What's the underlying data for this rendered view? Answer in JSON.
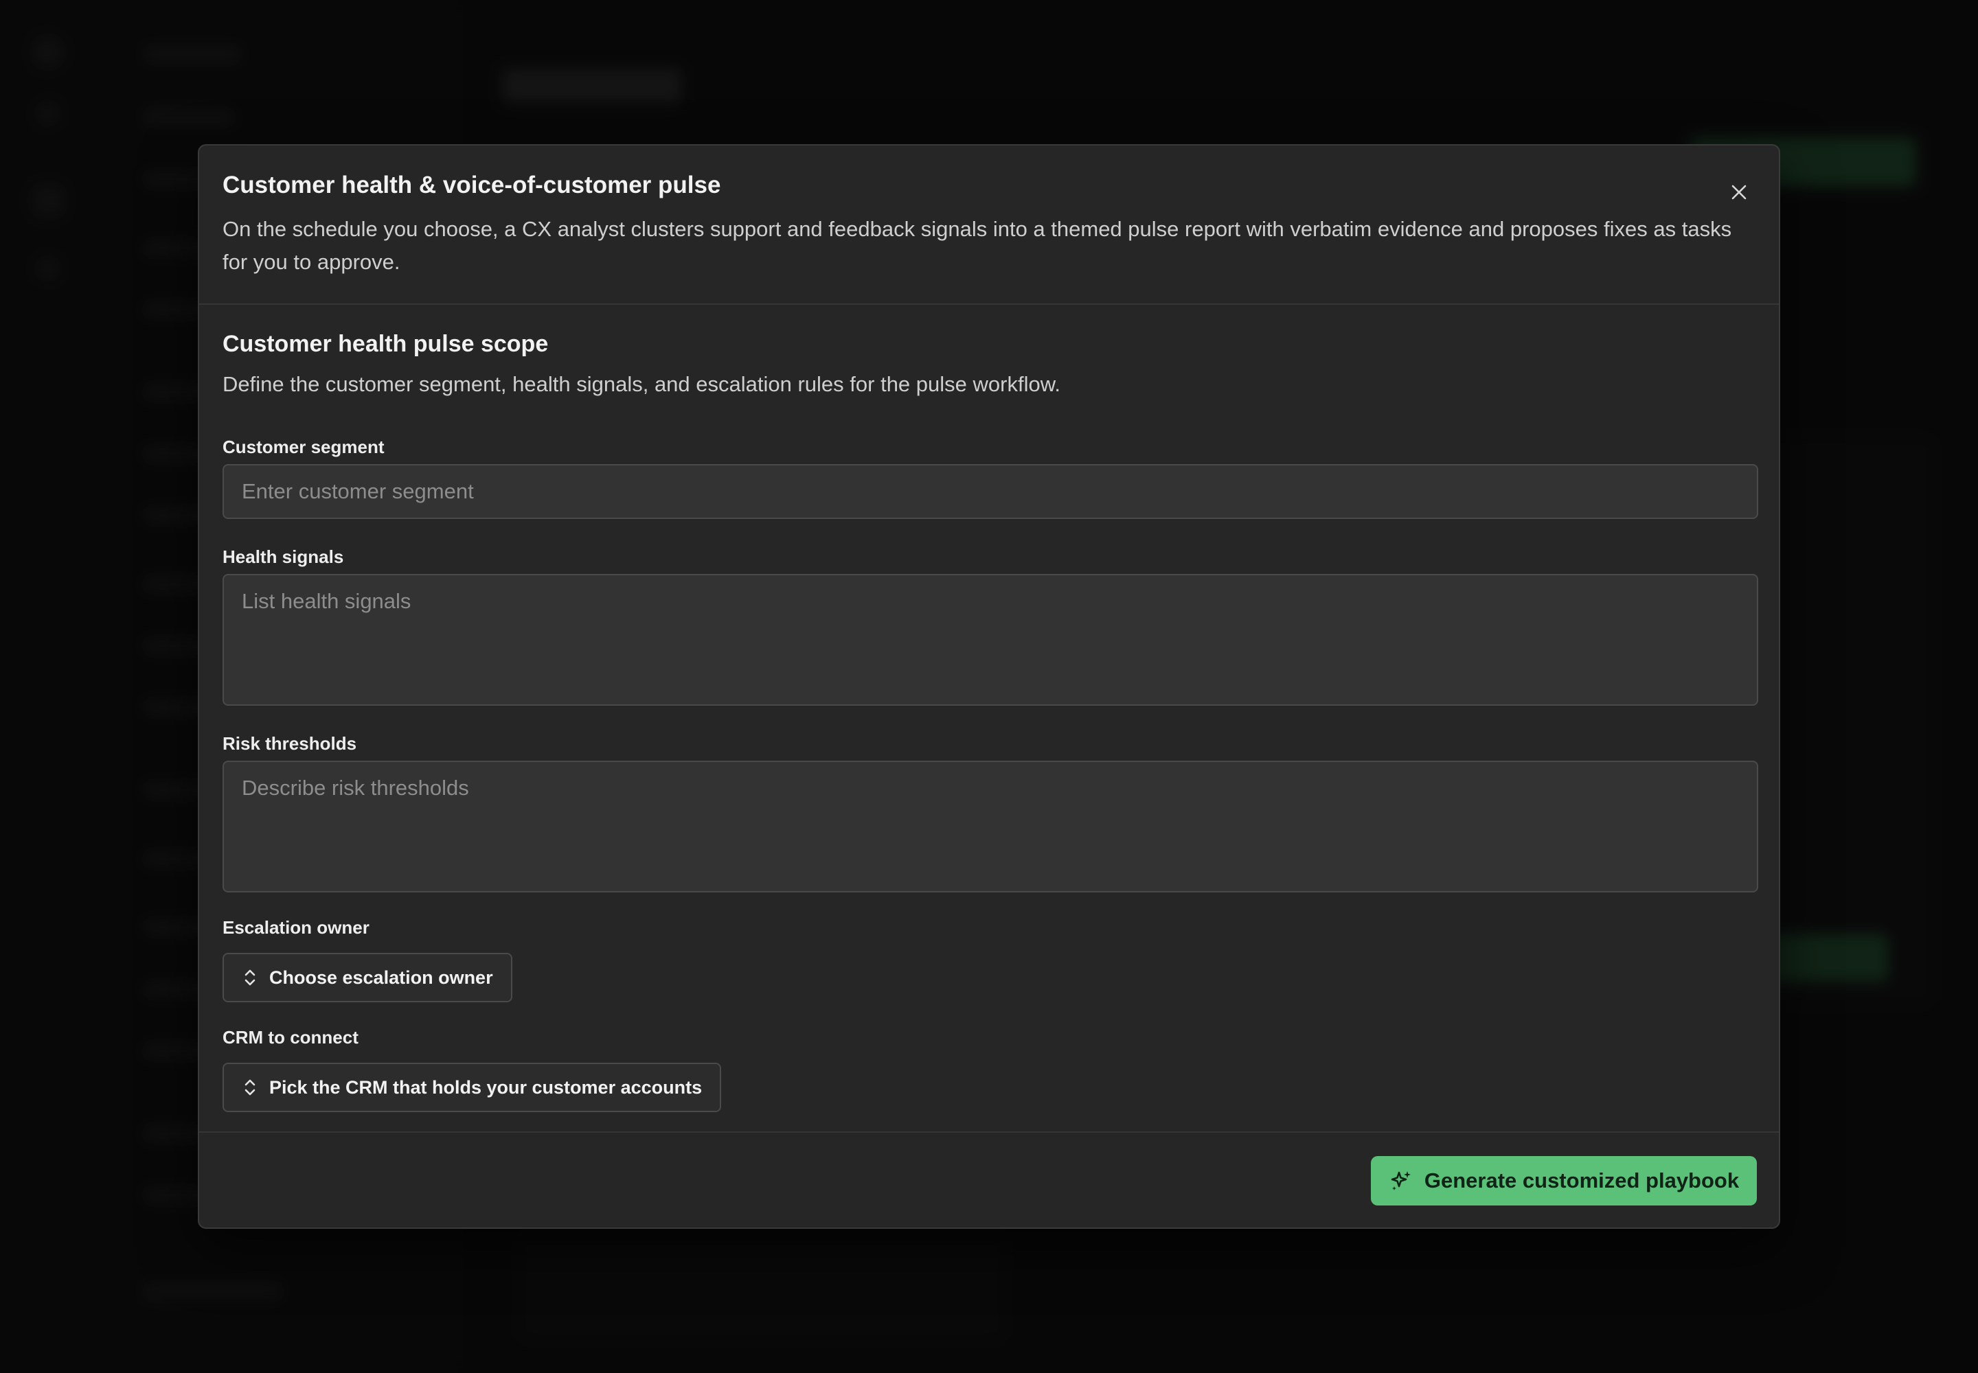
{
  "background_app": {
    "page_title": "Playbooks"
  },
  "modal": {
    "title": "Customer health & voice-of-customer pulse",
    "description": "On the schedule you choose, a CX analyst clusters support and feedback signals into a themed pulse report with verbatim evidence and proposes fixes as tasks for you to approve.",
    "close_icon": "close-icon",
    "section": {
      "title": "Customer health pulse scope",
      "description": "Define the customer segment, health signals, and escalation rules for the pulse workflow."
    },
    "fields": {
      "customer_segment": {
        "label": "Customer segment",
        "placeholder": "Enter customer segment",
        "value": ""
      },
      "health_signals": {
        "label": "Health signals",
        "placeholder": "List health signals",
        "value": ""
      },
      "risk_thresholds": {
        "label": "Risk thresholds",
        "placeholder": "Describe risk thresholds",
        "value": ""
      },
      "escalation_owner": {
        "label": "Escalation owner",
        "button_label": "Choose escalation owner",
        "icon": "chevron-up-down-icon"
      },
      "crm": {
        "label": "CRM to connect",
        "button_label": "Pick the CRM that holds your customer accounts",
        "icon": "chevron-up-down-icon"
      }
    },
    "footer": {
      "primary_label": "Generate customized playbook",
      "primary_icon": "sparkles-icon"
    }
  },
  "colors": {
    "accent": "#5cc178",
    "modal_bg": "#262626",
    "input_bg": "#333333"
  }
}
